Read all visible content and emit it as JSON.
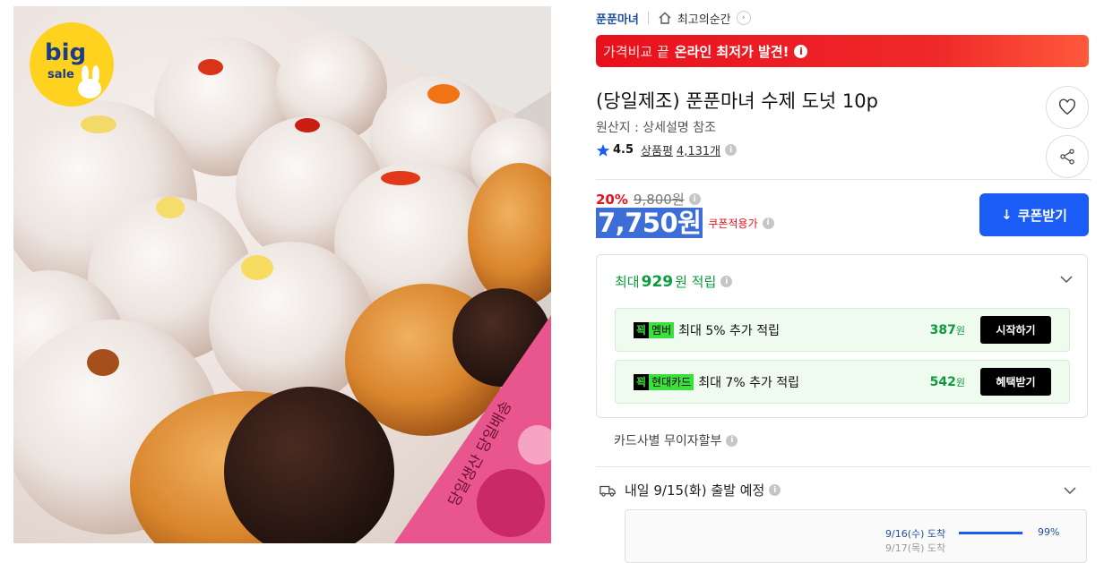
{
  "image": {
    "badge_line1": "big",
    "badge_line2": "sale",
    "box_print": "당일생산 당일배송"
  },
  "breadcrumb": {
    "brand": "푼푼마녀",
    "category": "최고의순간",
    "chevron": "›"
  },
  "promo_banner": {
    "soft_text": "가격비교 끝",
    "strong_text": "온라인 최저가 발견!",
    "info_glyph": "i"
  },
  "product": {
    "title": "(당일제조) 푼푼마녀 수제 도넛 10p",
    "origin": "원산지 : 상세설명 참조",
    "rating_score": "4.5",
    "reviews_label": "상품평",
    "reviews_count": "4,131개"
  },
  "price": {
    "discount_rate": "20%",
    "original_price": "9,800원",
    "final_price": "7,750원",
    "coupon_note": "쿠폰적용가"
  },
  "coupon_button": {
    "label": "쿠폰받기",
    "icon": "↓"
  },
  "points": {
    "prefix": "최대",
    "amount": "929",
    "suffix": "원 적립",
    "rows": [
      {
        "tag_k": "꾁",
        "tag_n": "멤버",
        "text": "최대 5% 추가 적립",
        "amount": "387",
        "unit": "원",
        "action": "시작하기"
      },
      {
        "tag_k": "꾁",
        "tag_n": "현대카드",
        "text": "최대 7% 추가 적립",
        "amount": "542",
        "unit": "원",
        "action": "혜택받기"
      }
    ]
  },
  "installment": "카드사별 무이자할부",
  "shipping": {
    "label": "내일 9/15(화) 출발 예정",
    "eta": "9/16(수) 도착",
    "percent_label": "99%",
    "percent_value": 0.99,
    "next_line": "9/17(목) 도착"
  },
  "colors": {
    "accent_blue": "#1a5cf5",
    "sale_red": "#e8101c",
    "points_green": "#0a9c3d"
  }
}
